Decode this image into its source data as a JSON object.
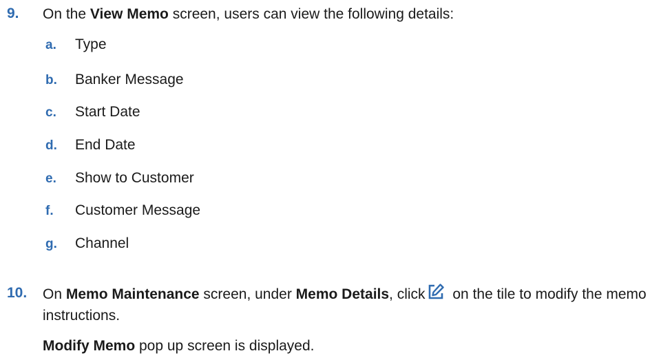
{
  "step9": {
    "number": "9.",
    "prefix": "On the ",
    "screen": "View Memo",
    "suffix": " screen, users can view the following details:"
  },
  "details": [
    {
      "letter": "a.",
      "label": "Type"
    },
    {
      "letter": "b.",
      "label": "Banker Message"
    },
    {
      "letter": "c.",
      "label": "Start Date"
    },
    {
      "letter": "d.",
      "label": "End Date"
    },
    {
      "letter": "e.",
      "label": "Show to Customer"
    },
    {
      "letter": "f.",
      "label": "Customer Message"
    },
    {
      "letter": "g.",
      "label": "Channel"
    }
  ],
  "step10": {
    "number": "10.",
    "part1": "On ",
    "screen": "Memo Maintenance",
    "part2": " screen, under ",
    "section": "Memo Details",
    "part3": ", click",
    "icon": "edit-icon",
    "part4": " on the tile to modify the memo instructions."
  },
  "result": {
    "bold": "Modify Memo",
    "rest": " pop up screen is displayed."
  },
  "colors": {
    "accent": "#2f6bb0",
    "text": "#1a1a1a"
  }
}
